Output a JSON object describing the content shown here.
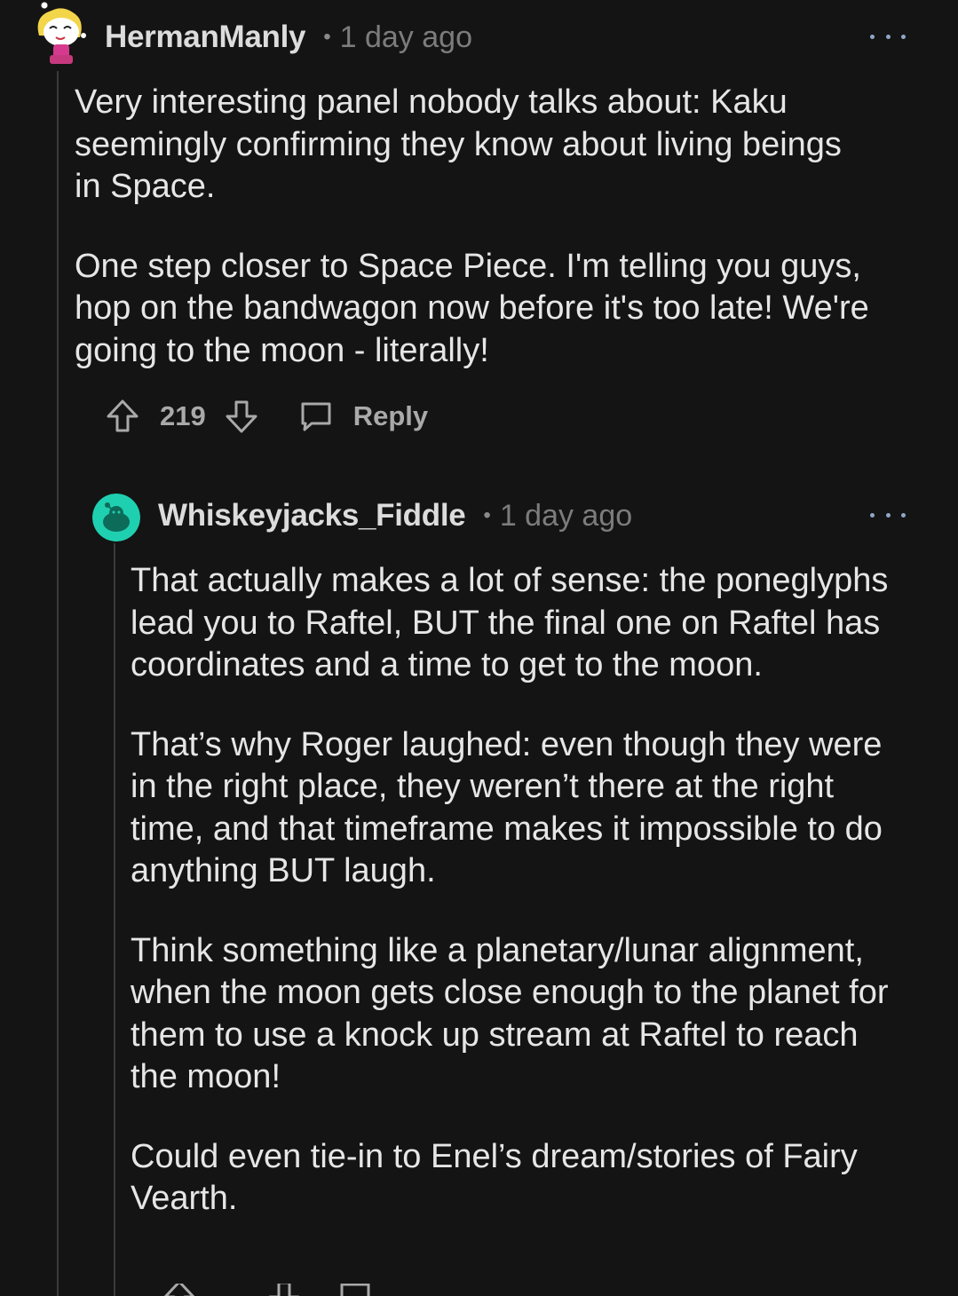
{
  "comments": [
    {
      "username": "HermanManly",
      "separator": "•",
      "timestamp": "1 day ago",
      "paragraphs": [
        "Very interesting panel nobody talks about: Kaku seemingly confirming they know about living beings in Space.",
        "One step closer to Space Piece. I'm telling you guys, hop on the bandwagon now before it's too late! We're going to the moon - literally!"
      ],
      "votes": "219",
      "reply_label": "Reply"
    },
    {
      "username": "Whiskeyjacks_Fiddle",
      "separator": "•",
      "timestamp": "1 day ago",
      "paragraphs": [
        "That actually makes a lot of sense: the poneglyphs lead you to Raftel, BUT the final one on Raftel has coordinates and a time to get to the moon.",
        "That’s why Roger laughed: even though they were in the right place, they weren’t there at the right time, and that timeframe makes it impossible to do anything BUT laugh.",
        "Think something like a planetary/lunar alignment, when the moon gets close enough to the planet for them to use a knock up stream at Raftel to reach the moon!",
        "Could even tie-in to Enel’s dream/stories of Fairy Vearth."
      ]
    }
  ],
  "icons": {
    "upvote": "arrow-up-outline-icon",
    "downvote": "arrow-down-outline-icon",
    "reply": "speech-bubble-icon",
    "more": "three-dots-icon"
  },
  "colors": {
    "background": "#141414",
    "text": "#e6e6e6",
    "muted": "#7c7c7c",
    "accent_dots": "#8fa7c9",
    "avatar_teal": "#1fd0b0"
  }
}
